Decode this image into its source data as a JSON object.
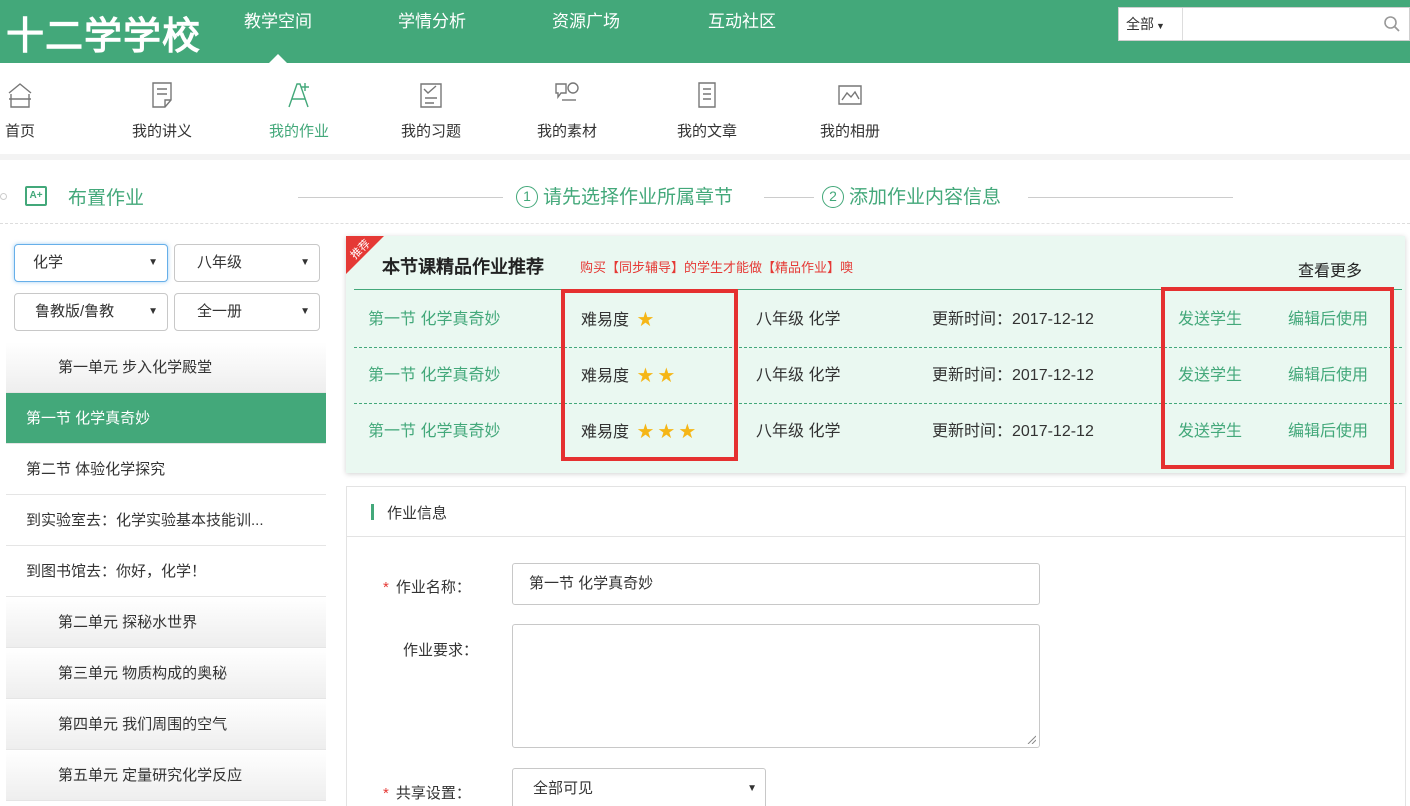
{
  "header": {
    "logo": "十二学学校",
    "nav": [
      "教学空间",
      "学情分析",
      "资源广场",
      "互动社区"
    ],
    "search": {
      "scope": "全部",
      "placeholder": ""
    }
  },
  "iconnav": [
    {
      "label": "首页",
      "icon": "home-icon"
    },
    {
      "label": "我的讲义",
      "icon": "handout-icon"
    },
    {
      "label": "我的作业",
      "icon": "homework-icon"
    },
    {
      "label": "我的习题",
      "icon": "exercise-icon"
    },
    {
      "label": "我的素材",
      "icon": "material-icon"
    },
    {
      "label": "我的文章",
      "icon": "article-icon"
    },
    {
      "label": "我的相册",
      "icon": "album-icon"
    }
  ],
  "steps": {
    "title": "布置作业",
    "step1": "请先选择作业所属章节",
    "step2": "添加作业内容信息",
    "n1": "1",
    "n2": "2"
  },
  "filters": {
    "subject": "化学",
    "grade": "八年级",
    "edition": "鲁教版/鲁教",
    "volume": "全一册"
  },
  "chapters": [
    {
      "label": "第一单元 步入化学殿堂",
      "type": "unit"
    },
    {
      "label": "第一节 化学真奇妙",
      "type": "sec",
      "active": true
    },
    {
      "label": "第二节 体验化学探究",
      "type": "sec"
    },
    {
      "label": "到实验室去：化学实验基本技能训...",
      "type": "sec"
    },
    {
      "label": "到图书馆去：你好，化学！",
      "type": "sec"
    },
    {
      "label": "第二单元 探秘水世界",
      "type": "unit"
    },
    {
      "label": "第三单元 物质构成的奥秘",
      "type": "unit"
    },
    {
      "label": "第四单元 我们周围的空气",
      "type": "unit"
    },
    {
      "label": "第五单元 定量研究化学反应",
      "type": "unit"
    }
  ],
  "recommend": {
    "badge": "推荐",
    "title": "本节课精品作业推荐",
    "subtitle": "购买【同步辅导】的学生才能做【精品作业】噢",
    "more": "查看更多",
    "difficulty_label": "难易度",
    "send_label": "发送学生",
    "edit_label": "编辑后使用",
    "rows": [
      {
        "name": "第一节 化学真奇妙",
        "difficulty": 1,
        "grade": "八年级 化学",
        "updated": "更新时间：2017-12-12"
      },
      {
        "name": "第一节 化学真奇妙",
        "difficulty": 2,
        "grade": "八年级 化学",
        "updated": "更新时间：2017-12-12"
      },
      {
        "name": "第一节 化学真奇妙",
        "difficulty": 3,
        "grade": "八年级 化学",
        "updated": "更新时间：2017-12-12"
      }
    ]
  },
  "info": {
    "title": "作业信息",
    "required_mark": "*",
    "name_label": "作业名称：",
    "name_value": "第一节 化学真奇妙",
    "req_label": "作业要求：",
    "req_value": "",
    "share_label": "共享设置：",
    "share_value": "全部可见"
  },
  "colors": {
    "brand": "#43a87a",
    "highlight": "#e53030",
    "recommend_bg": "#eaf8f1",
    "star": "#f5b617"
  }
}
